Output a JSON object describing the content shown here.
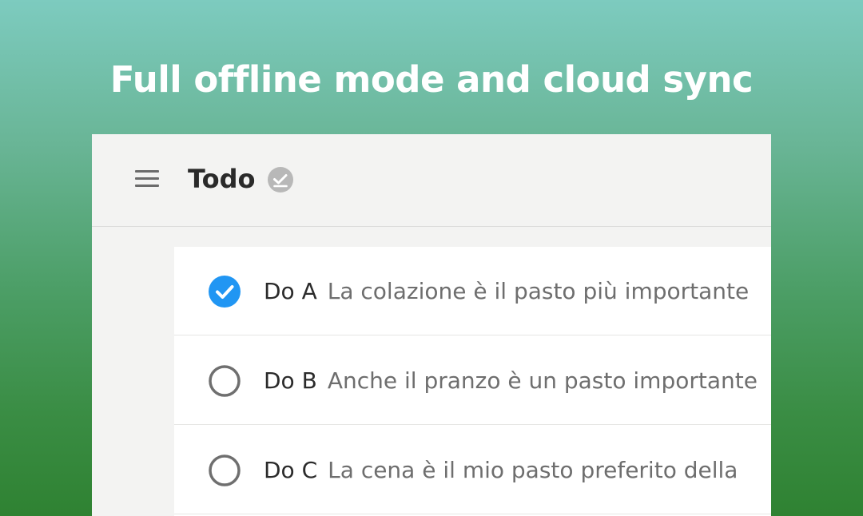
{
  "promo": {
    "headline": "Full offline mode and cloud sync"
  },
  "header": {
    "menu_icon": "hamburger-menu-icon",
    "title": "Todo",
    "sync_icon": "sync-done-icon"
  },
  "todos": [
    {
      "name": "Do A",
      "description": "La colazione è il pasto più importante",
      "checked": true
    },
    {
      "name": "Do B",
      "description": "Anche il pranzo è un pasto importante",
      "checked": false
    },
    {
      "name": "Do C",
      "description": "La cena è il mio pasto preferito della",
      "checked": false
    }
  ],
  "colors": {
    "checked": "#2196f3",
    "unchecked_ring": "#6f6f6f",
    "sync_badge": "#b8b8b8"
  }
}
